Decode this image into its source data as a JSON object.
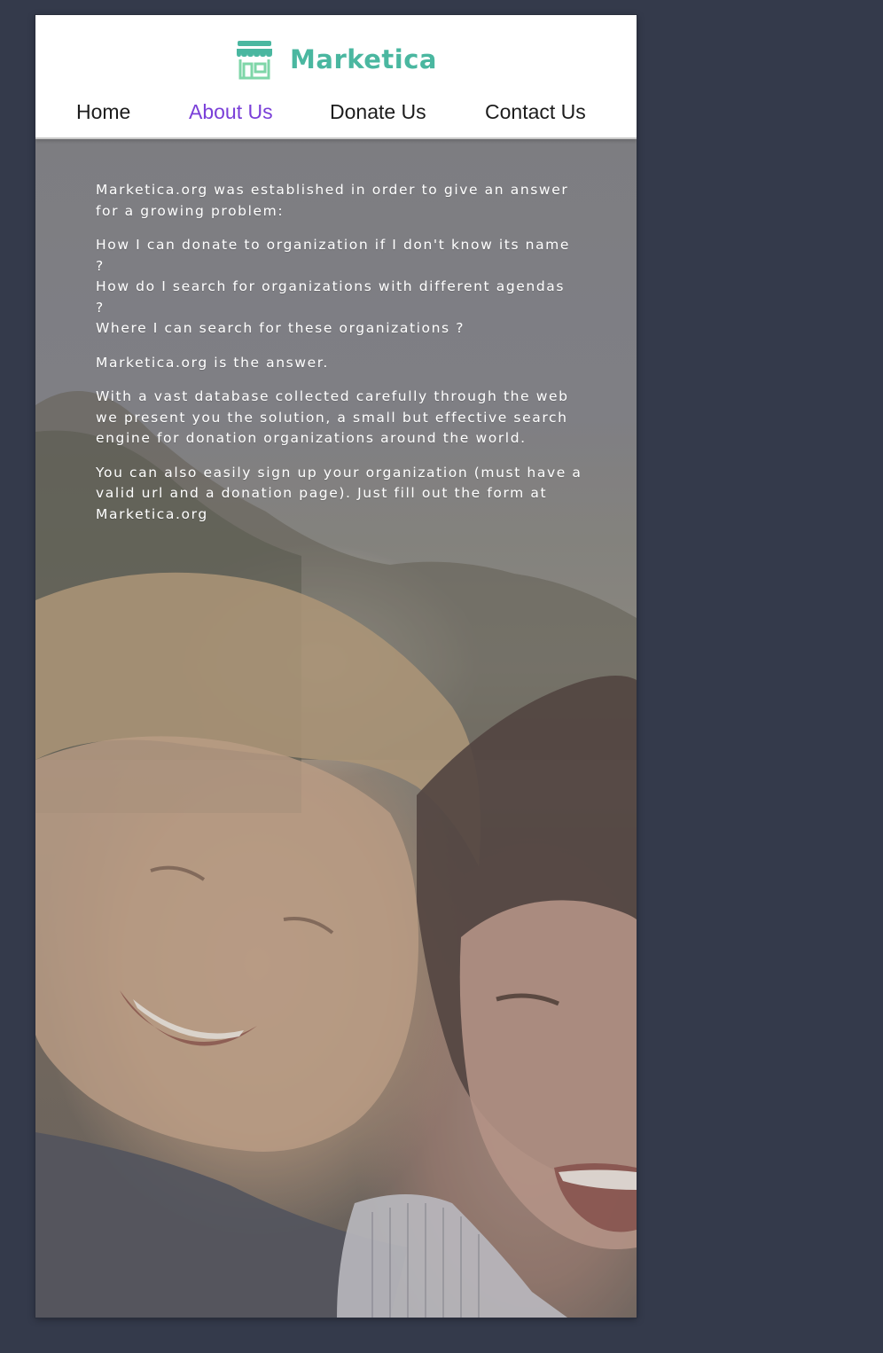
{
  "brand": {
    "name": "Marketica",
    "icon": "storefront-icon",
    "color": "#4ab7a0"
  },
  "nav": {
    "items": [
      {
        "label": "Home",
        "active": false
      },
      {
        "label": "About Us",
        "active": true
      },
      {
        "label": "Donate Us",
        "active": false
      },
      {
        "label": "Contact Us",
        "active": false
      }
    ],
    "active_color": "#7a3fd8"
  },
  "about": {
    "paragraphs": [
      "Marketica.org was established in order to give an answer for a growing problem:",
      "How I can donate to organization if I don't know its name\n?\nHow do I search for organizations with different agendas\n?\nWhere I can search for these organizations ?",
      "Marketica.org is the answer.",
      "With a vast database collected carefully through the web we present you the solution, a small but effective search engine for donation organizations around the world.",
      "You can also easily sign up your organization (must have a valid url and a donation page). Just fill out the form at Marketica.org"
    ]
  },
  "hero": {
    "image": "smiling-children-photo"
  }
}
